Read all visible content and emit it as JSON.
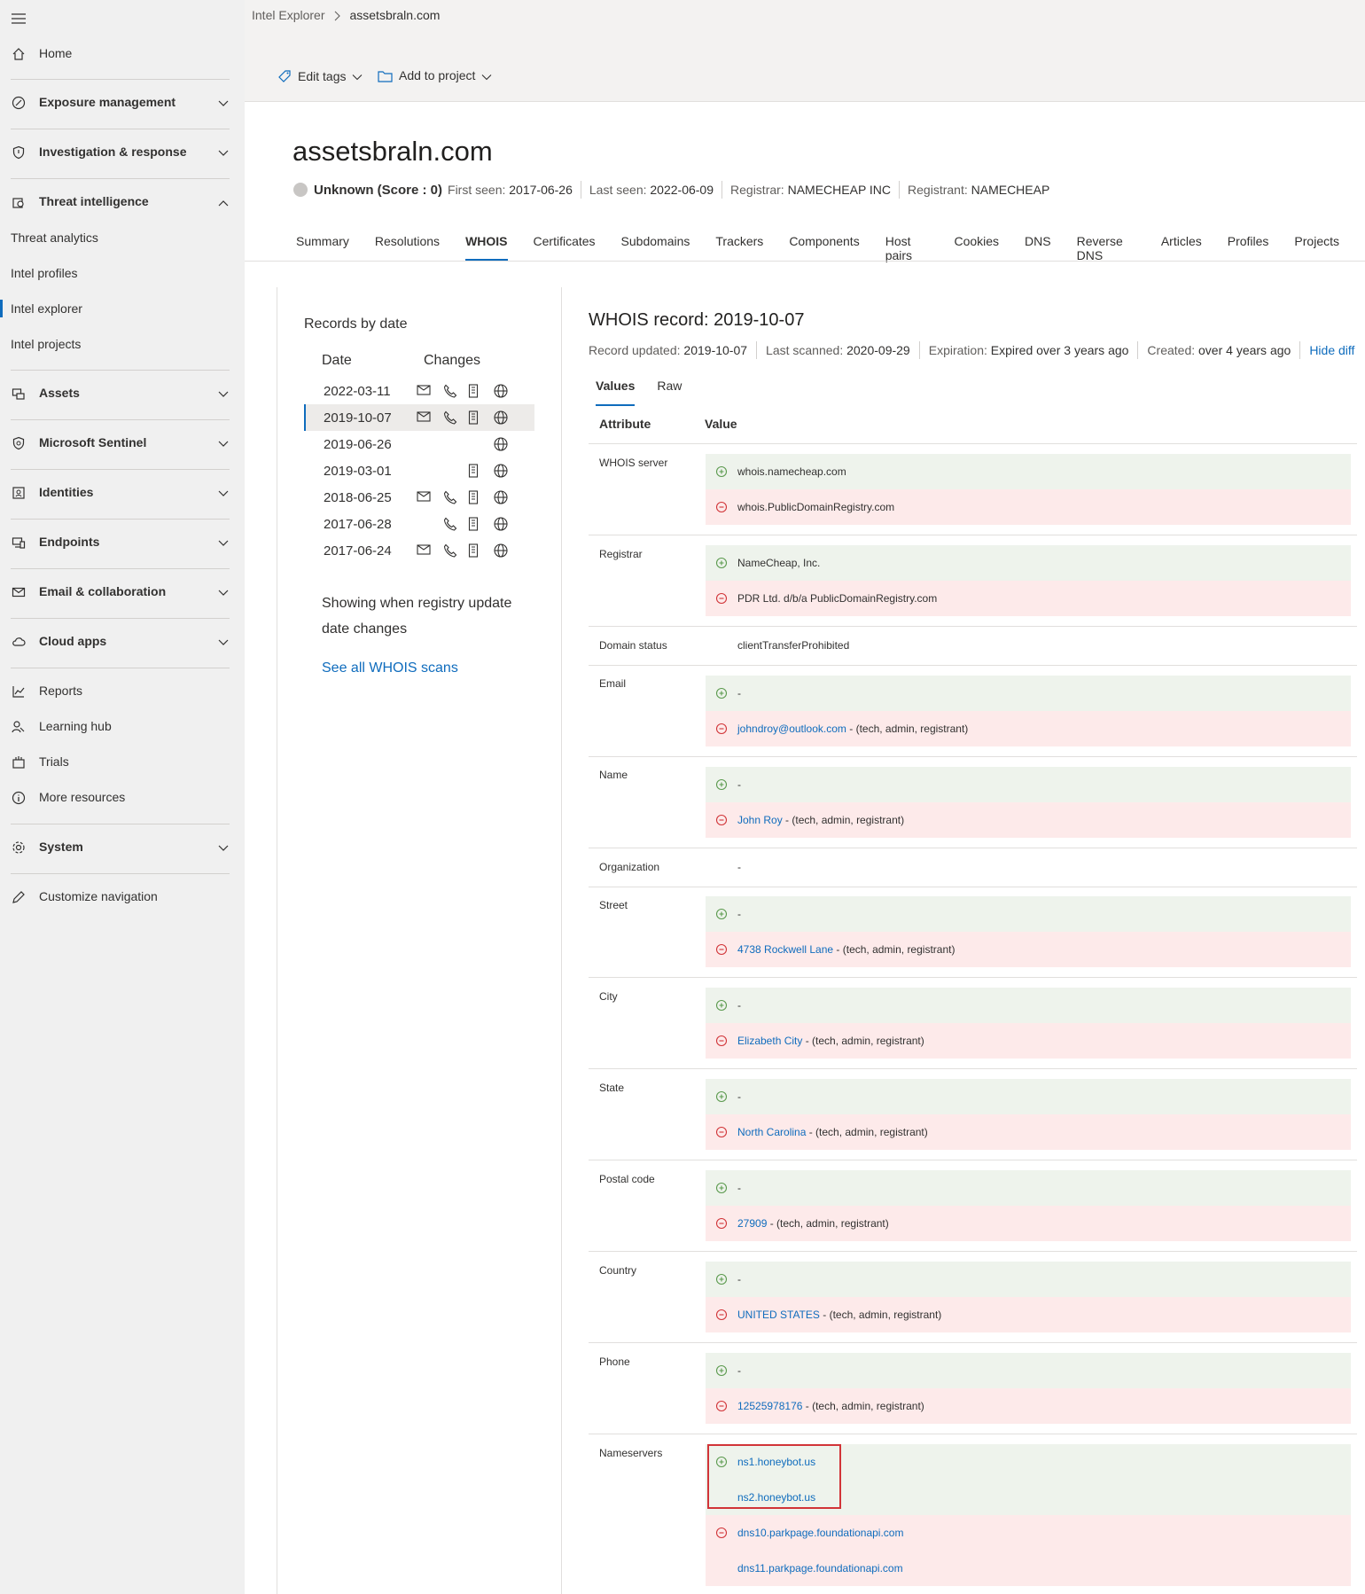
{
  "sidebar": {
    "items": [
      {
        "label": "Home"
      },
      {
        "label": "Exposure management"
      },
      {
        "label": "Investigation & response"
      },
      {
        "label": "Threat intelligence"
      },
      {
        "label": "Threat analytics"
      },
      {
        "label": "Intel profiles"
      },
      {
        "label": "Intel explorer"
      },
      {
        "label": "Intel projects"
      },
      {
        "label": "Assets"
      },
      {
        "label": "Microsoft Sentinel"
      },
      {
        "label": "Identities"
      },
      {
        "label": "Endpoints"
      },
      {
        "label": "Email & collaboration"
      },
      {
        "label": "Cloud apps"
      },
      {
        "label": "Reports"
      },
      {
        "label": "Learning hub"
      },
      {
        "label": "Trials"
      },
      {
        "label": "More resources"
      },
      {
        "label": "System"
      },
      {
        "label": "Customize navigation"
      }
    ]
  },
  "breadcrumb": {
    "root": "Intel Explorer",
    "current": "assetsbraln.com"
  },
  "toolbar": {
    "edit_tags": "Edit tags",
    "add_to_project": "Add to project"
  },
  "header": {
    "domain": "assetsbraln.com",
    "reputation": "Unknown (Score : 0)",
    "first_seen_label": "First seen:",
    "first_seen": "2017-06-26",
    "last_seen_label": "Last seen:",
    "last_seen": "2022-06-09",
    "registrar_label": "Registrar:",
    "registrar": "NAMECHEAP INC",
    "registrant_label": "Registrant:",
    "registrant": "NAMECHEAP"
  },
  "tabs": [
    "Summary",
    "Resolutions",
    "WHOIS",
    "Certificates",
    "Subdomains",
    "Trackers",
    "Components",
    "Host pairs",
    "Cookies",
    "DNS",
    "Reverse DNS",
    "Articles",
    "Profiles",
    "Projects"
  ],
  "records": {
    "title": "Records by date",
    "col_date": "Date",
    "col_changes": "Changes",
    "rows": [
      {
        "date": "2022-03-11"
      },
      {
        "date": "2019-10-07"
      },
      {
        "date": "2019-06-26"
      },
      {
        "date": "2019-03-01"
      },
      {
        "date": "2018-06-25"
      },
      {
        "date": "2017-06-28"
      },
      {
        "date": "2017-06-24"
      }
    ],
    "note": "Showing when registry update date changes",
    "see_all": "See all WHOIS scans"
  },
  "whois": {
    "title": "WHOIS record: 2019-10-07",
    "updated_label": "Record updated:",
    "updated": "2019-10-07",
    "scanned_label": "Last scanned:",
    "scanned": "2020-09-29",
    "expiration_label": "Expiration:",
    "expiration": "Expired over 3 years ago",
    "created_label": "Created:",
    "created": "over 4 years ago",
    "hide_diff": "Hide diff",
    "view_tabs": [
      "Values",
      "Raw"
    ],
    "col_attribute": "Attribute",
    "col_value": "Value",
    "attrs": {
      "whois_server": "WHOIS server",
      "registrar": "Registrar",
      "domain_status": "Domain status",
      "email": "Email",
      "name": "Name",
      "organization": "Organization",
      "street": "Street",
      "city": "City",
      "state": "State",
      "postal": "Postal code",
      "country": "Country",
      "phone": "Phone",
      "nameservers": "Nameservers"
    },
    "values": {
      "whois_add": "whois.namecheap.com",
      "whois_rem": "whois.PublicDomainRegistry.com",
      "registrar_add": "NameCheap, Inc.",
      "registrar_rem": "PDR Ltd. d/b/a PublicDomainRegistry.com",
      "domain_status": "clientTransferProhibited",
      "dash": "-",
      "roles": " - (tech, admin, registrant)",
      "email_rem": "johndroy@outlook.com",
      "name_rem": "John Roy",
      "street_rem": "4738 Rockwell Lane",
      "city_rem": "Elizabeth City",
      "state_rem": "North Carolina",
      "postal_rem": "27909",
      "country_rem": "UNITED STATES",
      "phone_rem": "12525978176",
      "ns_add_1": "ns1.honeybot.us",
      "ns_add_2": "ns2.honeybot.us",
      "ns_rem_1": "dns10.parkpage.foundationapi.com",
      "ns_rem_2": "dns11.parkpage.foundationapi.com"
    }
  },
  "colors": {
    "accent": "#0f6cbd",
    "added_bg": "#eef3ec",
    "removed_bg": "#fdeaea",
    "highlight": "#d13438"
  }
}
